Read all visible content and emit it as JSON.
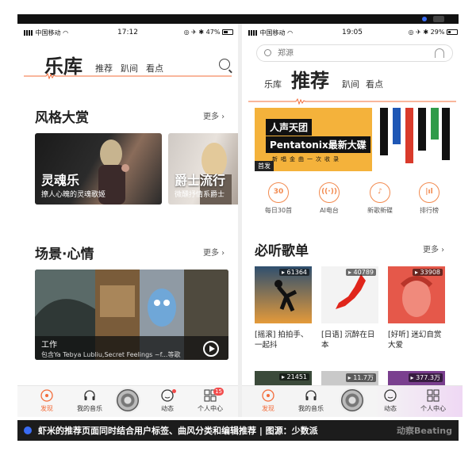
{
  "left_phone": {
    "status": {
      "carrier": "中国移动",
      "time": "17:12",
      "battery": "47%",
      "battery_level": 0.47
    },
    "header": {
      "title": "乐库",
      "tabs": [
        "推荐",
        "趴间",
        "看点"
      ]
    },
    "sections": [
      {
        "title": "风格大赏",
        "more": "更多",
        "cards": [
          {
            "title": "灵魂乐",
            "subtitle": "撩人心魄的灵魂歌姬"
          },
          {
            "title": "爵士流行",
            "subtitle": "微醺抒情系爵士"
          }
        ]
      },
      {
        "title": "场景·心情",
        "more": "更多",
        "cards": [
          {
            "title": "工作",
            "subtitle": "包含Ya Tebya Lubliu,Secret Feelings ~f...等歌"
          }
        ]
      }
    ],
    "nav": [
      {
        "label": "发现",
        "active": true
      },
      {
        "label": "我的音乐"
      },
      {
        "label": ""
      },
      {
        "label": "动态",
        "dot": true
      },
      {
        "label": "个人中心",
        "badge": "15"
      }
    ]
  },
  "right_phone": {
    "status": {
      "carrier": "中国移动",
      "time": "19:05",
      "battery": "29%",
      "battery_level": 0.29
    },
    "search": {
      "placeholder": "郑源"
    },
    "tabs": {
      "left": "乐库",
      "active": "推荐",
      "right1": "趴间",
      "right2": "看点"
    },
    "banner": {
      "line1": "人声天团",
      "line2": "Pentatonix最新大碟",
      "line3": "新唱金曲一次收录",
      "tag": "首发"
    },
    "quick_links": [
      {
        "label": "每日30首",
        "icon_text": "30"
      },
      {
        "label": "AI电台",
        "icon_text": "((·))"
      },
      {
        "label": "新歌新碟",
        "icon_text": "♪"
      },
      {
        "label": "排行榜",
        "icon_text": "|ıl"
      }
    ],
    "playlist_section": {
      "title": "必听歌单",
      "more": "更多",
      "albums": [
        {
          "count": "61364",
          "label": "[摇滚] 拍拍手、一起抖"
        },
        {
          "count": "40789",
          "label": "[日语] 沉醉在日本"
        },
        {
          "count": "33908",
          "label": "[好听] 迷幻自赏大爱"
        }
      ],
      "albums_row2": [
        {
          "count": "21451"
        },
        {
          "count": "11.7万"
        },
        {
          "count": "377.3万"
        }
      ]
    },
    "nav": [
      {
        "label": "发现",
        "active": true
      },
      {
        "label": "我的音乐"
      },
      {
        "label": ""
      },
      {
        "label": "动态"
      },
      {
        "label": "个人中心"
      }
    ]
  },
  "caption": {
    "text": "虾米的推荐页面同时结合用户标签、曲风分类和编辑推荐 | 图源：少数派",
    "brand": "动察Beating"
  },
  "colors": {
    "accent": "#f36c3a",
    "banner": "#f4b23b",
    "caption_bg": "#1c1c1c"
  }
}
